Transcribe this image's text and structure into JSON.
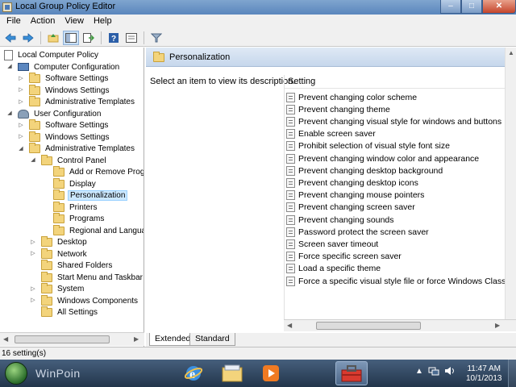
{
  "window": {
    "title": "Local Group Policy Editor",
    "minimize": "–",
    "maximize": "□",
    "close": "✕"
  },
  "menu": [
    {
      "label": "File"
    },
    {
      "label": "Action"
    },
    {
      "label": "View"
    },
    {
      "label": "Help"
    }
  ],
  "toolbar": {
    "buttons": [
      "back-icon",
      "forward-icon",
      "up-folder-icon",
      "show-hide-tree-icon",
      "export-list-icon",
      "help-icon",
      "properties-icon",
      "filter-icon"
    ]
  },
  "tree": [
    {
      "label": "Local Computer Policy",
      "icon": "policy",
      "depth": 0,
      "expander": ""
    },
    {
      "label": "Computer Configuration",
      "icon": "computer",
      "depth": 1,
      "expander": "◢"
    },
    {
      "label": "Software Settings",
      "icon": "folder",
      "depth": 2,
      "expander": "▷"
    },
    {
      "label": "Windows Settings",
      "icon": "folder",
      "depth": 2,
      "expander": "▷"
    },
    {
      "label": "Administrative Templates",
      "icon": "folder",
      "depth": 2,
      "expander": "▷"
    },
    {
      "label": "User Configuration",
      "icon": "users",
      "depth": 1,
      "expander": "◢"
    },
    {
      "label": "Software Settings",
      "icon": "folder",
      "depth": 2,
      "expander": "▷"
    },
    {
      "label": "Windows Settings",
      "icon": "folder",
      "depth": 2,
      "expander": "▷"
    },
    {
      "label": "Administrative Templates",
      "icon": "folder",
      "depth": 2,
      "expander": "◢"
    },
    {
      "label": "Control Panel",
      "icon": "folder",
      "depth": 3,
      "expander": "◢"
    },
    {
      "label": "Add or Remove Programs",
      "icon": "folder",
      "depth": 4,
      "expander": ""
    },
    {
      "label": "Display",
      "icon": "folder",
      "depth": 4,
      "expander": ""
    },
    {
      "label": "Personalization",
      "icon": "folder",
      "depth": 4,
      "expander": "",
      "selected": true
    },
    {
      "label": "Printers",
      "icon": "folder",
      "depth": 4,
      "expander": ""
    },
    {
      "label": "Programs",
      "icon": "folder",
      "depth": 4,
      "expander": ""
    },
    {
      "label": "Regional and Language Options",
      "icon": "folder",
      "depth": 4,
      "expander": ""
    },
    {
      "label": "Desktop",
      "icon": "folder",
      "depth": 3,
      "expander": "▷"
    },
    {
      "label": "Network",
      "icon": "folder",
      "depth": 3,
      "expander": "▷"
    },
    {
      "label": "Shared Folders",
      "icon": "folder",
      "depth": 3,
      "expander": ""
    },
    {
      "label": "Start Menu and Taskbar",
      "icon": "folder",
      "depth": 3,
      "expander": ""
    },
    {
      "label": "System",
      "icon": "folder",
      "depth": 3,
      "expander": "▷"
    },
    {
      "label": "Windows Components",
      "icon": "folder",
      "depth": 3,
      "expander": "▷"
    },
    {
      "label": "All Settings",
      "icon": "folder",
      "depth": 3,
      "expander": ""
    }
  ],
  "details": {
    "node_title": "Personalization",
    "description": "Select an item to view its description.",
    "column_header": "Setting",
    "settings": [
      "Prevent changing color scheme",
      "Prevent changing theme",
      "Prevent changing visual style for windows and buttons",
      "Enable screen saver",
      "Prohibit selection of visual style font size",
      "Prevent changing window color and appearance",
      "Prevent changing desktop background",
      "Prevent changing desktop icons",
      "Prevent changing mouse pointers",
      "Prevent changing screen saver",
      "Prevent changing sounds",
      "Password protect the screen saver",
      "Screen saver timeout",
      "Force specific screen saver",
      "Load a specific theme",
      "Force a specific visual style file or force Windows Classic"
    ]
  },
  "tabs": {
    "extended": "Extended",
    "standard": "Standard"
  },
  "status": {
    "text": "16 setting(s)"
  },
  "taskbar": {
    "watermark": "WinPoin",
    "time": "11:47 AM",
    "date": "10/1/2013"
  }
}
